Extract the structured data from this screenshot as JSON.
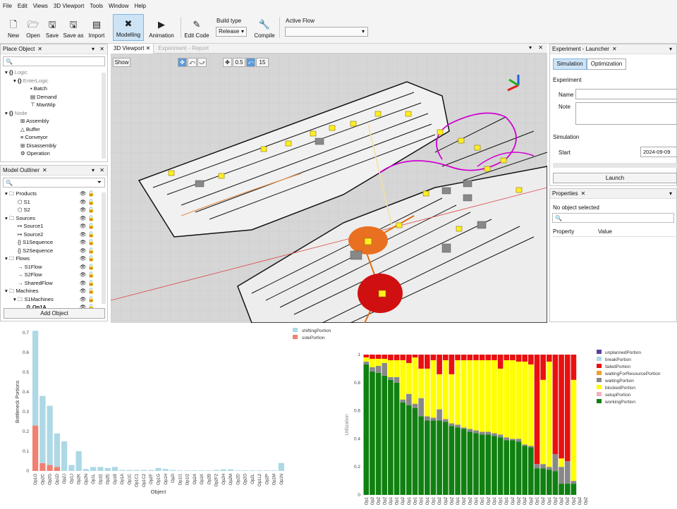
{
  "menu": [
    "File",
    "Edit",
    "Views",
    "3D Viewport",
    "Tools",
    "Window",
    "Help"
  ],
  "toolbar": {
    "new": "New",
    "open": "Open",
    "save": "Save",
    "saveas": "Save as",
    "import": "Import",
    "modelling": "Modelling",
    "animation": "Animation",
    "editcode": "Edit Code",
    "buildtype_label": "Build type",
    "buildtype_value": "Release",
    "compile": "Compile",
    "activeflow_label": "Active Flow"
  },
  "place": {
    "title": "Place Object",
    "items": [
      "Logic",
      "EnterLogic",
      "Batch",
      "Demand",
      "MaxWip",
      "Node",
      "Assembly",
      "Buffer",
      "Conveyor",
      "Disassembly",
      "Operation"
    ]
  },
  "outliner": {
    "title": "Model Outliner",
    "items": [
      "Products",
      "S1",
      "S2",
      "Sources",
      "Source1",
      "Source2",
      "S1Sequence",
      "S2Sequence",
      "Flows",
      "S1Flow",
      "S2Flow",
      "SharedFlow",
      "Machines",
      "S1Machines",
      "Op1A"
    ],
    "add": "Add Object"
  },
  "viewport": {
    "tab": "3D Viewport",
    "tab2": "Experiment - Report",
    "show": "Show",
    "speed": "0.5",
    "fps": "15"
  },
  "experiment": {
    "title": "Experiment - Launcher",
    "simulation_tab": "Simulation",
    "optimization_tab": "Optimization",
    "section": "Experiment",
    "name": "Name",
    "note": "Note",
    "sim_section": "Simulation",
    "start": "Start",
    "start_value": "2024-09-09 16",
    "launch": "Launch"
  },
  "properties": {
    "title": "Properties",
    "empty": "No object selected",
    "col1": "Property",
    "col2": "Value"
  },
  "chart_left": {
    "type": "bar",
    "ylabel": "Bottleneck Portions",
    "xlabel": "Object",
    "legend": [
      "shiftingPortion",
      "solePortion"
    ],
    "colors": {
      "shifting": "#add8e6",
      "sole": "#f08070"
    },
    "ylim": [
      0,
      0.7
    ],
    "yticks": [
      "0",
      "0.1",
      "0.2",
      "0.3",
      "0.4",
      "0.5",
      "0.6",
      "0.7"
    ],
    "categories": [
      "Op1O",
      "Op2C",
      "Op2G",
      "Op1D",
      "Op2J",
      "Op1J",
      "Op2K",
      "Op2N",
      "Op1L",
      "Op1E",
      "Op2E",
      "Op1B",
      "Op1A",
      "Op1C",
      "Op1C1",
      "Op1C2",
      "Op2F",
      "Op1G",
      "Op1H",
      "Op2I",
      "Op1I1",
      "Op1I2",
      "Op2A",
      "Op1K",
      "Op2B",
      "Op2F2",
      "Op2H",
      "Op2M",
      "Op2D",
      "Op2O",
      "Op2L",
      "Op1L2",
      "Op2P",
      "Op1M",
      "Op1N"
    ],
    "shifting": [
      0.48,
      0.34,
      0.3,
      0.17,
      0.15,
      0.03,
      0.1,
      0.01,
      0.02,
      0.02,
      0.015,
      0.02,
      0.005,
      0.005,
      0.005,
      0.005,
      0.005,
      0.015,
      0.01,
      0.005,
      0.003,
      0.003,
      0.003,
      0.003,
      0.003,
      0.005,
      0.008,
      0.008,
      0.003,
      0.003,
      0.003,
      0.003,
      0.003,
      0.003,
      0.04
    ],
    "sole": [
      0.23,
      0.04,
      0.03,
      0.02,
      0,
      0,
      0,
      0,
      0,
      0,
      0,
      0,
      0,
      0,
      0,
      0,
      0,
      0,
      0,
      0,
      0,
      0,
      0,
      0,
      0,
      0,
      0,
      0,
      0,
      0,
      0,
      0,
      0,
      0,
      0
    ]
  },
  "chart_right": {
    "type": "bar",
    "ylabel": "Utilization",
    "legend": [
      "unplannedPortion",
      "breakPortion",
      "failedPortion",
      "waitingForResourcePortion",
      "waitingPortion",
      "blockedPortion",
      "setupPortion",
      "workingPortion"
    ],
    "colors": [
      "#5b3fa0",
      "#add8e6",
      "#e81010",
      "#f0a030",
      "#888888",
      "#ffff00",
      "#f0b0c0",
      "#108010"
    ],
    "yticks": [
      "0",
      "0.2",
      "0.4",
      "0.6",
      "0.8",
      "1"
    ],
    "categories": [
      "Op1",
      "Op2",
      "Op2",
      "Op2",
      "Op1",
      "Op1",
      "Op2",
      "Op1",
      "Op1",
      "Op1",
      "Op1",
      "Op1",
      "Op2",
      "Op2",
      "Op2",
      "Op1",
      "Op2",
      "Op2",
      "Op1",
      "Op1",
      "Op2",
      "Op1",
      "Op1",
      "Op1",
      "Op2",
      "Op2",
      "Op2",
      "Op2",
      "Op1",
      "Op2",
      "Op1",
      "Op2",
      "Op2",
      "Op2",
      "Op2",
      "Op2",
      "Op2"
    ],
    "working": [
      0.93,
      0.88,
      0.87,
      0.85,
      0.82,
      0.8,
      0.66,
      0.64,
      0.62,
      0.56,
      0.53,
      0.53,
      0.53,
      0.52,
      0.49,
      0.48,
      0.47,
      0.45,
      0.44,
      0.43,
      0.43,
      0.42,
      0.41,
      0.39,
      0.39,
      0.38,
      0.35,
      0.34,
      0.19,
      0.19,
      0.18,
      0.17,
      0.08,
      0.08,
      0.08,
      0.0,
      0.0
    ],
    "waiting": [
      0.02,
      0.03,
      0.05,
      0.09,
      0.02,
      0.04,
      0.02,
      0.08,
      0.03,
      0.13,
      0.03,
      0.02,
      0.08,
      0.02,
      0.02,
      0.02,
      0.01,
      0.02,
      0.02,
      0.02,
      0.02,
      0.02,
      0.02,
      0.02,
      0.01,
      0.02,
      0.01,
      0.01,
      0.03,
      0.03,
      0.02,
      0.12,
      0.12,
      0.16,
      0.02,
      0.0,
      0.0
    ],
    "blocked": [
      0.03,
      0.06,
      0.05,
      0.03,
      0.12,
      0.12,
      0.28,
      0.22,
      0.33,
      0.21,
      0.34,
      0.41,
      0.25,
      0.42,
      0.35,
      0.46,
      0.48,
      0.49,
      0.5,
      0.51,
      0.51,
      0.52,
      0.47,
      0.55,
      0.56,
      0.55,
      0.59,
      0.58,
      0.0,
      0.6,
      0.75,
      0.0,
      0.06,
      0.0,
      0.72,
      0.0,
      0.0
    ],
    "failed": [
      0.02,
      0.03,
      0.03,
      0.03,
      0.04,
      0.04,
      0.04,
      0.06,
      0.02,
      0.1,
      0.1,
      0.04,
      0.14,
      0.04,
      0.14,
      0.04,
      0.04,
      0.04,
      0.04,
      0.04,
      0.04,
      0.04,
      0.1,
      0.04,
      0.04,
      0.05,
      0.05,
      0.07,
      0.78,
      0.18,
      0.05,
      0.71,
      0.74,
      0.76,
      0.18,
      0.0,
      0.0
    ]
  }
}
